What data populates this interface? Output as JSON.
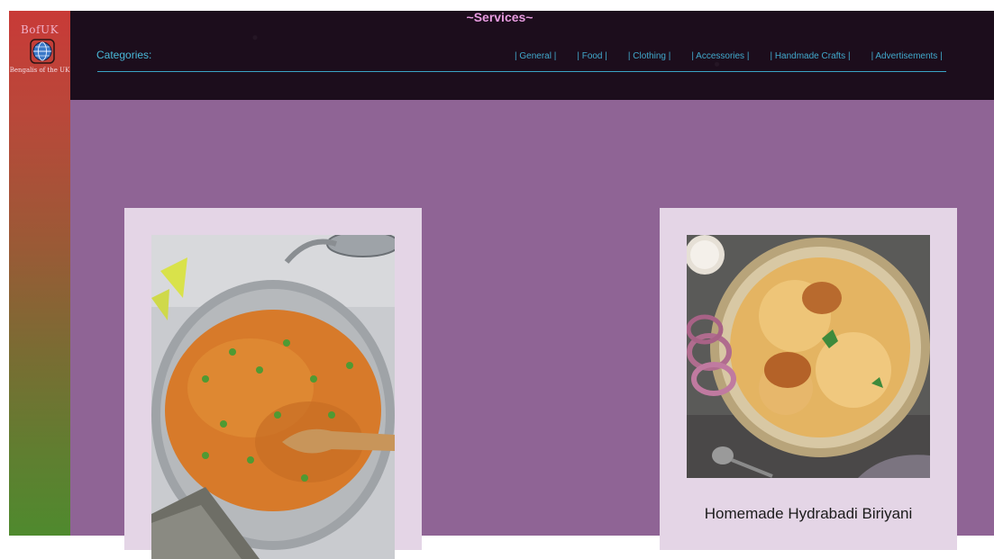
{
  "brand": {
    "logo_text": "BofUK",
    "caption": "Bengalis of the UK"
  },
  "header": {
    "title": "~Services~",
    "categories_label": "Categories:",
    "nav": [
      {
        "label": "| General |"
      },
      {
        "label": "| Food |"
      },
      {
        "label": "| Clothing |"
      },
      {
        "label": "| Accessories |"
      },
      {
        "label": "| Handmade Crafts |"
      },
      {
        "label": "| Advertisements |"
      }
    ]
  },
  "cards": [
    {
      "title": ""
    },
    {
      "title": "Homemade Hydrabadi Biriyani"
    }
  ],
  "colors": {
    "header_bg": "#1c0d1c",
    "accent": "#41a9cc",
    "title": "#e79be0",
    "main_bg": "#8f6495",
    "card_bg": "#e4d5e6"
  }
}
